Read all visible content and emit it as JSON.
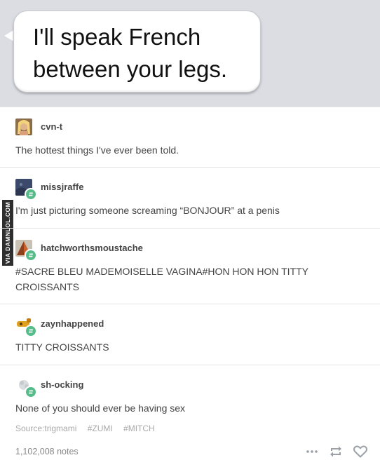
{
  "message_bubble": {
    "text": "I'll speak French between your legs."
  },
  "watermark": {
    "text": "VIA DAMNLOL.COM"
  },
  "posts": [
    {
      "username": "cvn-t",
      "text": "The hottest things I've ever been told.",
      "avatar_icon": "user-avatar-icon",
      "reblog": false
    },
    {
      "username": "missjraffe",
      "text": "I'm just picturing someone screaming “BONJOUR” at a penis",
      "avatar_icon": "user-avatar-icon",
      "reblog": true
    },
    {
      "username": "hatchworthsmoustache",
      "text": "#SACRE BLEU MADEMOISELLE VAGINA#HON HON HON TITTY CROISSANTS",
      "avatar_icon": "user-avatar-icon",
      "reblog": true
    },
    {
      "username": "zaynhappened",
      "text": "TITTY CROISSANTS",
      "avatar_icon": "user-avatar-icon",
      "reblog": true
    },
    {
      "username": "sh-ocking",
      "text": "None of you should ever be having sex",
      "avatar_icon": "user-avatar-icon",
      "reblog": true
    }
  ],
  "footer": {
    "source_label": "Source:trigmami",
    "tags": [
      "#ZUMI",
      "#MITCH"
    ],
    "notes": "1,102,008 notes",
    "icons": [
      "more-icon",
      "reblog-icon",
      "like-icon"
    ]
  },
  "colors": {
    "header_background": "#dbdde3",
    "reblog_badge": "#56bc8a",
    "text": "#444444",
    "muted": "#a9a9a9"
  }
}
